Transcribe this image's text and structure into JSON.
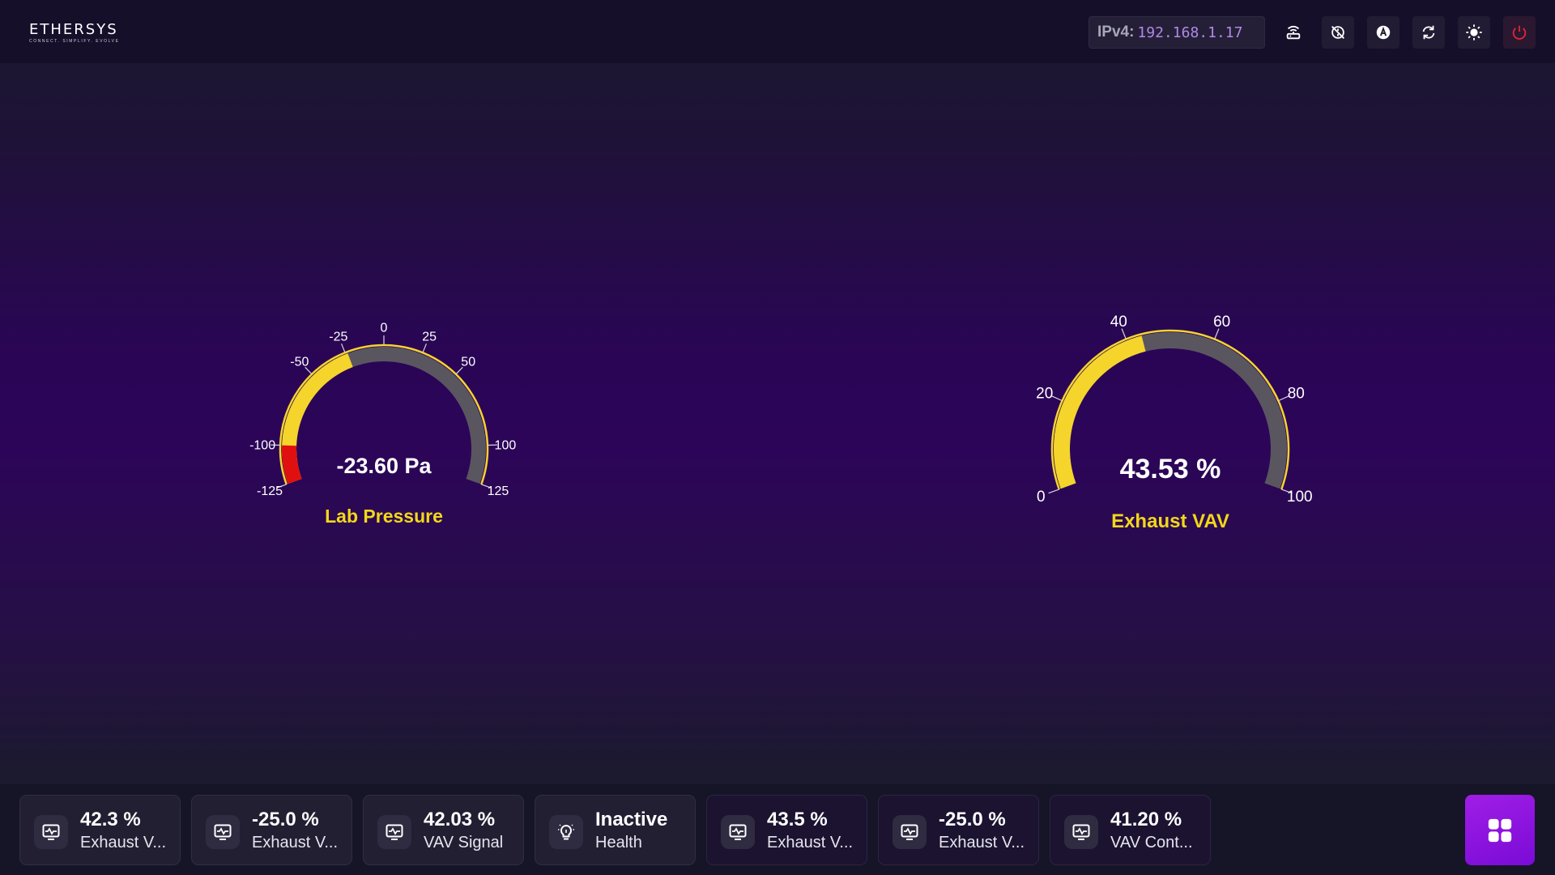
{
  "header": {
    "logo_text": "ETHERSYS",
    "logo_tagline": "CONNECT. SIMPLIFY. EVOLVE",
    "ip_label": "IPv4:",
    "ip_value": "192.168.1.17",
    "icons": [
      "router-icon",
      "sync-disabled-icon",
      "auto-mode-icon",
      "refresh-icon",
      "brightness-icon",
      "power-icon"
    ]
  },
  "gauges": [
    {
      "title": "Lab Pressure",
      "value_text": "-23.60 Pa",
      "value": -23.6,
      "min": -125,
      "max": 125,
      "ticks": [
        -125,
        -100,
        -50,
        -25,
        0,
        25,
        50,
        100,
        125
      ],
      "alarm_range": [
        -125,
        -100
      ],
      "fill_color": "#f5d42c",
      "track_color": "#5a5660",
      "alarm_color": "#e01010"
    },
    {
      "title": "Exhaust VAV",
      "value_text": "43.53 %",
      "value": 43.53,
      "min": 0,
      "max": 100,
      "ticks": [
        0,
        20,
        40,
        60,
        80,
        100
      ],
      "fill_color": "#f5d42c",
      "track_color": "#5a5660"
    }
  ],
  "cards": [
    {
      "value": "42.3 %",
      "label": "Exhaust V...",
      "icon": "monitor-heart-icon"
    },
    {
      "value": "-25.0 %",
      "label": "Exhaust V...",
      "icon": "monitor-heart-icon"
    },
    {
      "value": "42.03 %",
      "label": "VAV Signal",
      "icon": "monitor-heart-icon"
    },
    {
      "value": "Inactive",
      "label": "Health",
      "icon": "lightbulb-icon"
    },
    {
      "value": "43.5 %",
      "label": "Exhaust V...",
      "icon": "monitor-heart-icon"
    },
    {
      "value": "-25.0 %",
      "label": "Exhaust V...",
      "icon": "monitor-heart-icon"
    },
    {
      "value": "41.20 %",
      "label": "VAV Cont...",
      "icon": "monitor-heart-icon"
    }
  ],
  "app_button_icon": "apps-grid-icon",
  "colors": {
    "accent": "#f3d71a",
    "ip_value": "#b089e8",
    "power": "#e0243a",
    "app_button": "#9a16e2"
  }
}
